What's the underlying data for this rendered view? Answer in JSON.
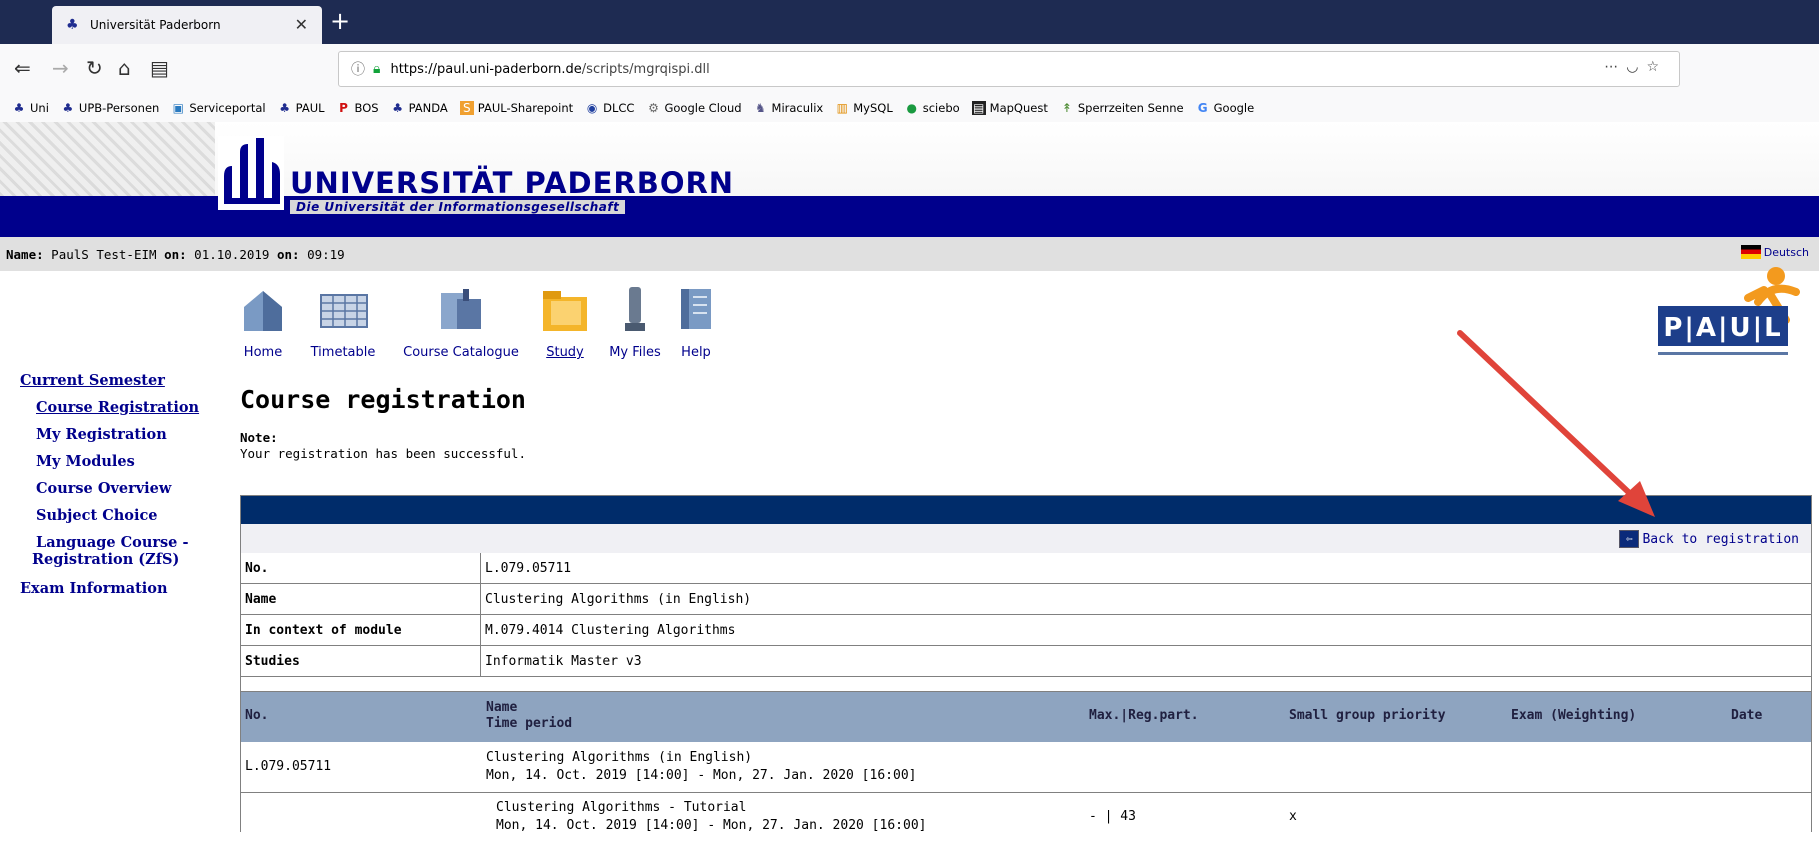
{
  "browser": {
    "tab_title": "Universität Paderborn",
    "url_host": "https://paul.uni-paderborn.de",
    "url_path": "/scripts/mgrqispi.dll",
    "bookmarks": [
      "Uni",
      "UPB-Personen",
      "Serviceportal",
      "PAUL",
      "BOS",
      "PANDA",
      "PAUL-Sharepoint",
      "DLCC",
      "Google Cloud",
      "Miraculix",
      "MySQL",
      "sciebo",
      "MapQuest",
      "Sperrzeiten Senne",
      "Google"
    ]
  },
  "banner": {
    "university": "UNIVERSITÄT PADERBORN",
    "slogan": "Die Universität der Informationsgesellschaft"
  },
  "status": {
    "name_label": "Name:",
    "name_value": "PaulS Test-EIM",
    "on_label1": "on:",
    "date": "01.10.2019",
    "on_label2": "on:",
    "time": "09:19",
    "language": "Deutsch"
  },
  "menu": {
    "items": [
      "Home",
      "Timetable",
      "Course Catalogue",
      "Study",
      "My Files",
      "Help"
    ]
  },
  "paul_logo": "P|A|U|L",
  "sidenav": {
    "current_semester": "Current Semester",
    "course_registration": "Course Registration",
    "my_registration": "My Registration",
    "my_modules": "My Modules",
    "course_overview": "Course Overview",
    "subject_choice": "Subject Choice",
    "language_course_1": "Language Course -",
    "language_course_2": "Registration (ZfS)",
    "exam_information": "Exam Information"
  },
  "page": {
    "title": "Course registration",
    "note_label": "Note:",
    "note_text": "Your registration has been successful.",
    "back_link": "Back to registration"
  },
  "details": [
    {
      "key": "No.",
      "value": "L.079.05711"
    },
    {
      "key": "Name",
      "value": "Clustering Algorithms (in English)"
    },
    {
      "key": "In context of module",
      "value": "M.079.4014 Clustering Algorithms"
    },
    {
      "key": "Studies",
      "value": "Informatik Master v3"
    }
  ],
  "table": {
    "headers": {
      "no": "No.",
      "name": "Name",
      "time_period": "Time period",
      "max_reg": "Max.|Reg.part.",
      "priority": "Small group priority",
      "exam": "Exam (Weighting)",
      "date": "Date"
    },
    "rows": [
      {
        "no": "L.079.05711",
        "name": "Clustering Algorithms (in English)",
        "period": "Mon, 14. Oct. 2019 [14:00] - Mon, 27. Jan. 2020 [16:00]",
        "max_reg": "",
        "priority": ""
      },
      {
        "no": "",
        "name": "Clustering Algorithms - Tutorial",
        "period": "Mon, 14. Oct. 2019 [14:00] - Mon, 27. Jan. 2020 [16:00]",
        "max_reg": "- | 43",
        "priority": "x"
      }
    ]
  }
}
